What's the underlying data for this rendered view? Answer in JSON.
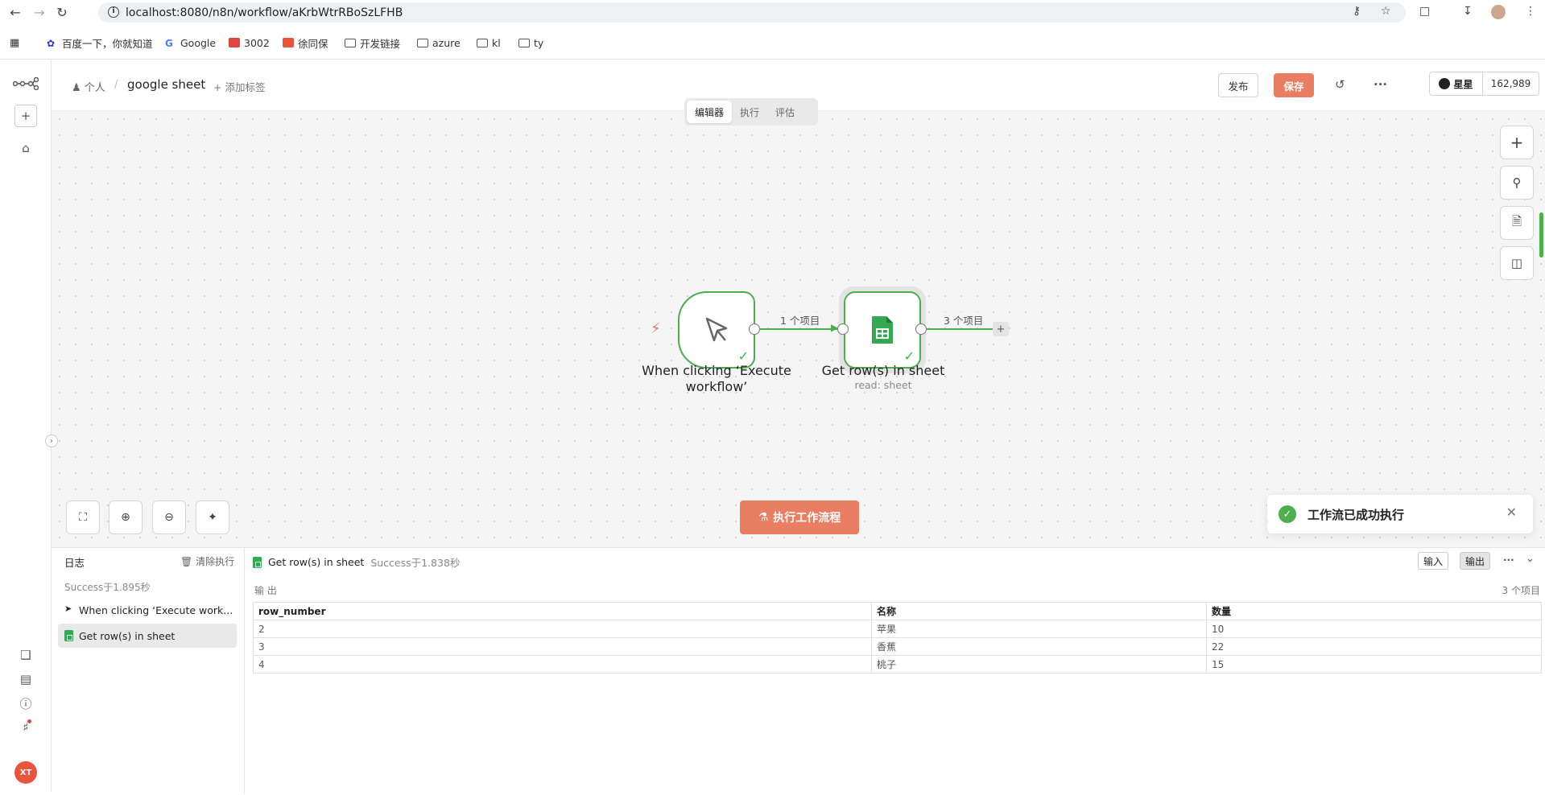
{
  "browser": {
    "url": "localhost:8080/n8n/workflow/aKrbWtrRBoSzLFHB",
    "bookmarks": [
      {
        "label": "百度一下，你就知道"
      },
      {
        "label": "Google"
      },
      {
        "label": "3002"
      },
      {
        "label": "徐同保"
      },
      {
        "label": "开发链接"
      },
      {
        "label": "azure"
      },
      {
        "label": "kl"
      },
      {
        "label": "ty"
      }
    ]
  },
  "header": {
    "breadcrumb_owner": "个人",
    "separator": "/",
    "workflow_name": "google sheet",
    "add_tag": "+ 添加标签",
    "publish_label": "发布",
    "save_label": "保存",
    "github_label": "星星",
    "github_count": "162,989"
  },
  "tabs": [
    {
      "label": "编辑器",
      "active": true
    },
    {
      "label": "执行"
    },
    {
      "label": "评估"
    }
  ],
  "nodes": {
    "trigger_label_line1": "When clicking ‘Execute",
    "trigger_label_line2": "workflow’",
    "sheet_label": "Get row(s) in sheet",
    "sheet_sub": "read: sheet",
    "edge1_label": "1 个项目",
    "edge2_label": "3 个项目"
  },
  "run_button_label": "执行工作流程",
  "toast": {
    "message": "工作流已成功执行"
  },
  "logs": {
    "title": "日志",
    "clear_label": "清除执行",
    "run_status": "Success于1.895秒",
    "items": [
      {
        "label": "When clicking ‘Execute work..."
      },
      {
        "label": "Get row(s) in sheet"
      }
    ],
    "output_node": "Get row(s) in sheet",
    "output_status": "Success于1.838秒",
    "input_btn": "输入",
    "output_btn": "输出",
    "output_label": "输 出",
    "output_count": "3 个项目",
    "columns": [
      "row_number",
      "名称",
      "数量"
    ],
    "rows": [
      [
        "2",
        "苹果",
        "10"
      ],
      [
        "3",
        "香蕉",
        "22"
      ],
      [
        "4",
        "桃子",
        "15"
      ]
    ]
  },
  "colors": {
    "accent": "#ea7e63",
    "success": "#4cae4c"
  }
}
